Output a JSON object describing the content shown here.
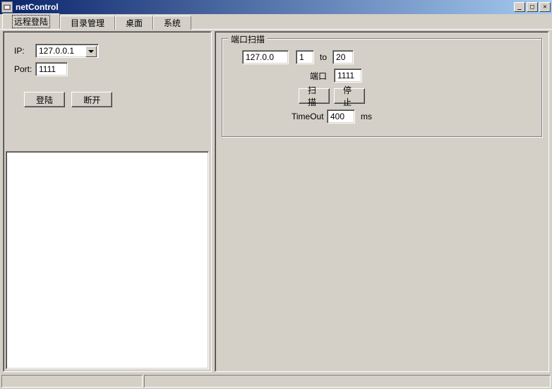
{
  "window": {
    "title": "netControl"
  },
  "tabs": [
    {
      "label": "远程登陆"
    },
    {
      "label": "目录管理"
    },
    {
      "label": "桌面"
    },
    {
      "label": "系统"
    }
  ],
  "login": {
    "ip_label": "IP:",
    "ip_value": "127.0.0.1",
    "port_label": "Port:",
    "port_value": "1111",
    "login_button": "登陆",
    "disconnect_button": "断开"
  },
  "portscan": {
    "group_title": "端口扫描",
    "ip_value": "127.0.0",
    "from_value": "1",
    "to_label": "to",
    "to_value": "20",
    "port_label": "端口",
    "port_value": "1111",
    "scan_button": "扫描",
    "stop_button": "停止",
    "timeout_label": "TimeOut",
    "timeout_value": "400",
    "timeout_unit": "ms"
  }
}
